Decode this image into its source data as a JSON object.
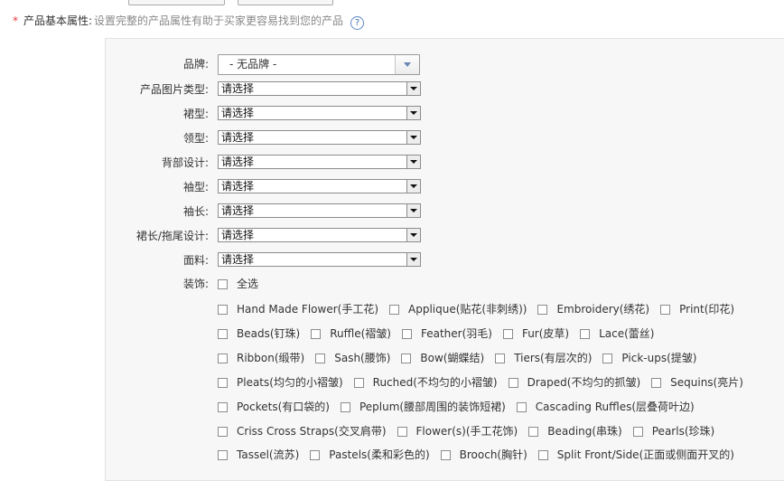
{
  "section": {
    "required_mark": "*",
    "title": "产品基本属性:",
    "hint": "设置完整的产品属性有助于买家更容易找到您的产品",
    "help_icon": "question-circle-icon"
  },
  "brand": {
    "label": "品牌:",
    "value": "- 无品牌 -"
  },
  "attributes": [
    {
      "label": "产品图片类型:",
      "value": "请选择"
    },
    {
      "label": "裙型:",
      "value": "请选择"
    },
    {
      "label": "领型:",
      "value": "请选择"
    },
    {
      "label": "背部设计:",
      "value": "请选择"
    },
    {
      "label": "袖型:",
      "value": "请选择"
    },
    {
      "label": "袖长:",
      "value": "请选择"
    },
    {
      "label": "裙长/拖尾设计:",
      "value": "请选择"
    },
    {
      "label": "面料:",
      "value": "请选择"
    }
  ],
  "decoration": {
    "label": "装饰:",
    "select_all": "全选",
    "rows": [
      [
        "Hand Made Flower(手工花)",
        "Applique(贴花(非刺绣))",
        "Embroidery(绣花)",
        "Print(印花)"
      ],
      [
        "Beads(钉珠)",
        "Ruffle(褶皱)",
        "Feather(羽毛)",
        "Fur(皮草)",
        "Lace(蕾丝)"
      ],
      [
        "Ribbon(缎带)",
        "Sash(腰饰)",
        "Bow(蝴蝶结)",
        "Tiers(有层次的)",
        "Pick-ups(提皱)"
      ],
      [
        "Pleats(均匀的小褶皱)",
        "Ruched(不均匀的小褶皱)",
        "Draped(不均匀的抓皱)",
        "Sequins(亮片)"
      ],
      [
        "Pockets(有口袋的)",
        "Peplum(腰部周围的装饰短裙)",
        "Cascading Ruffles(层叠荷叶边)"
      ],
      [
        "Criss Cross Straps(交叉肩带)",
        "Flower(s)(手工花饰)",
        "Beading(串珠)",
        "Pearls(珍珠)"
      ],
      [
        "Tassel(流苏)",
        "Pastels(柔和彩色的)",
        "Brooch(胸针)",
        "Split Front/Side(正面或侧面开叉的)"
      ]
    ]
  }
}
